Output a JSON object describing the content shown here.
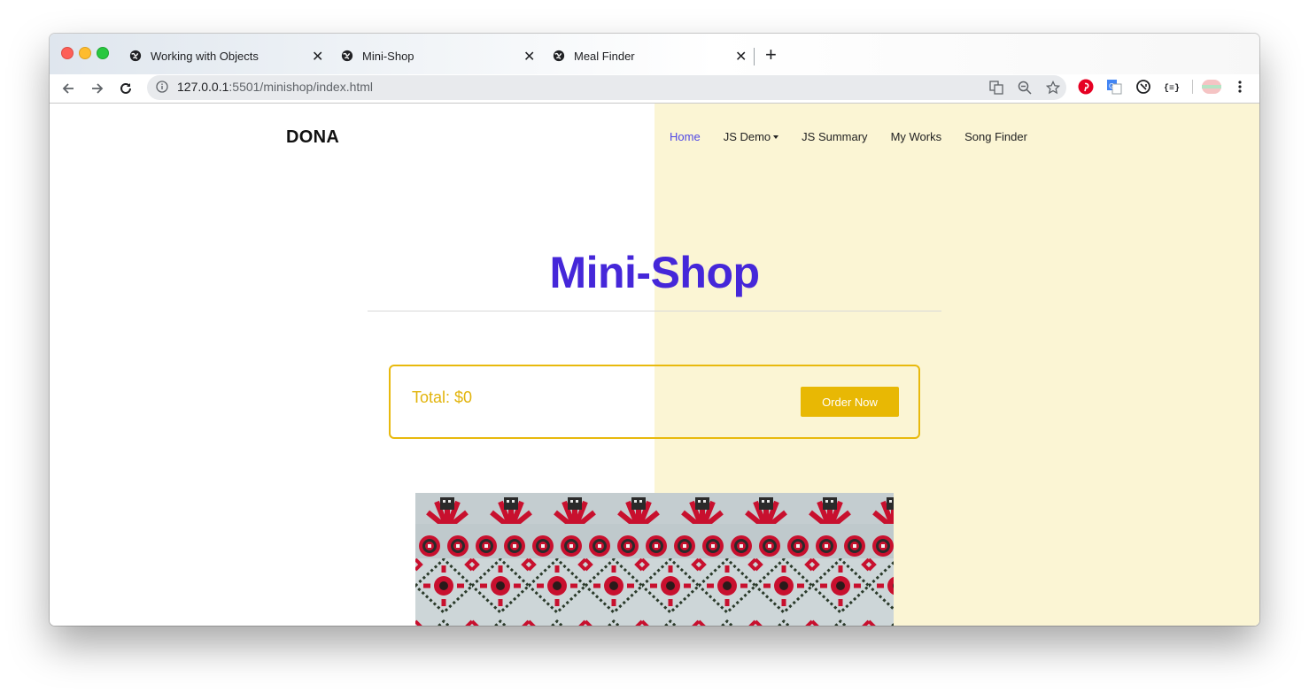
{
  "browser": {
    "tabs": [
      {
        "title": "Working with Objects",
        "active": false
      },
      {
        "title": "Mini-Shop",
        "active": true
      },
      {
        "title": "Meal Finder",
        "active": false
      }
    ],
    "close_glyph": "✕",
    "newtab_glyph": "+",
    "url_host": "127.0.0.1",
    "url_rest": ":5501/minishop/index.html",
    "nav_icons": [
      "back-icon",
      "forward-icon",
      "reload-icon"
    ],
    "extensions": [
      "pinterest-icon",
      "google-translate-icon",
      "sync-icon",
      "json-viewer-icon",
      "profile-avatar-icon",
      "more-menu-icon"
    ]
  },
  "site": {
    "brand": "DONA",
    "nav": [
      {
        "label": "Home",
        "active": true
      },
      {
        "label": "JS Demo",
        "dropdown": true
      },
      {
        "label": "JS Summary"
      },
      {
        "label": "My Works"
      },
      {
        "label": "Song Finder"
      }
    ],
    "title": "Mini-Shop",
    "total_label": "Total: $0",
    "order_button": "Order Now"
  },
  "colors": {
    "accent": "#4527d9",
    "gold": "#e8b804",
    "cream": "#fbf5d4",
    "nav_active": "#4f46e5"
  }
}
